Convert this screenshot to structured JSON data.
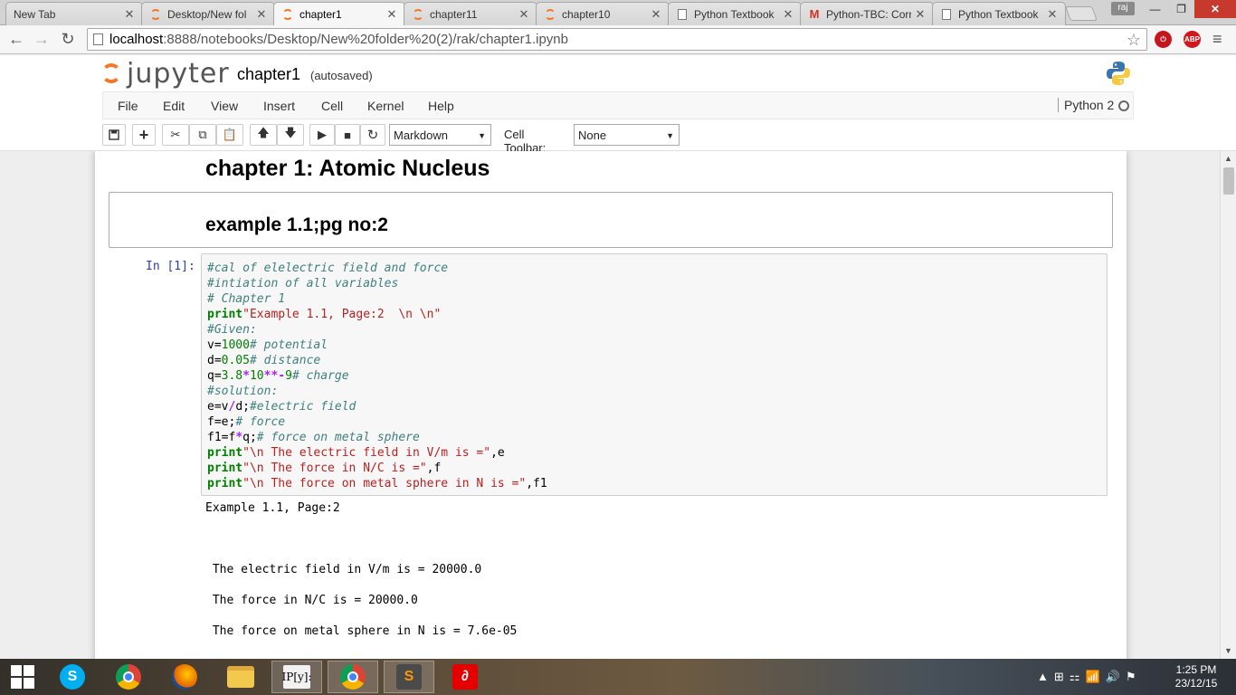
{
  "browser": {
    "tabs": [
      {
        "title": "New Tab",
        "icon": "none"
      },
      {
        "title": "Desktop/New fol",
        "icon": "jupyter"
      },
      {
        "title": "chapter1",
        "icon": "jupyter",
        "active": true
      },
      {
        "title": "chapter11",
        "icon": "jupyter"
      },
      {
        "title": "chapter10",
        "icon": "jupyter"
      },
      {
        "title": "Python Textbook",
        "icon": "page"
      },
      {
        "title": "Python-TBC: Corr",
        "icon": "gmail"
      },
      {
        "title": "Python Textbook",
        "icon": "page"
      }
    ],
    "user_badge": "raj",
    "url_host": "localhost",
    "url_path": ":8888/notebooks/Desktop/New%20folder%20(2)/rak/chapter1.ipynb",
    "ext_abp": "ABP"
  },
  "jupyter": {
    "logo_text": "jupyter",
    "notebook_name": "chapter1",
    "save_status": "(autosaved)",
    "menu": [
      "File",
      "Edit",
      "View",
      "Insert",
      "Cell",
      "Kernel",
      "Help"
    ],
    "kernel": "Python 2",
    "cell_type": "Markdown",
    "cell_toolbar_label": "Cell Toolbar:",
    "cell_toolbar_value": "None"
  },
  "notebook": {
    "heading": "chapter 1: Atomic Nucleus",
    "subheading": "example 1.1;pg no:2",
    "prompt": "In [1]:",
    "output_lines": [
      "Example 1.1, Page:2",
      "",
      "",
      "",
      " The electric field in V/m is = 20000.0",
      "",
      " The force in N/C is = 20000.0",
      "",
      " The force on metal sphere in N is = 7.6e-05"
    ]
  },
  "taskbar": {
    "time": "1:25 PM",
    "date": "23/12/15",
    "apps": [
      "skype",
      "chrome",
      "firefox",
      "file-explorer",
      "ipython",
      "chrome",
      "sublime-text",
      "airtel"
    ]
  }
}
